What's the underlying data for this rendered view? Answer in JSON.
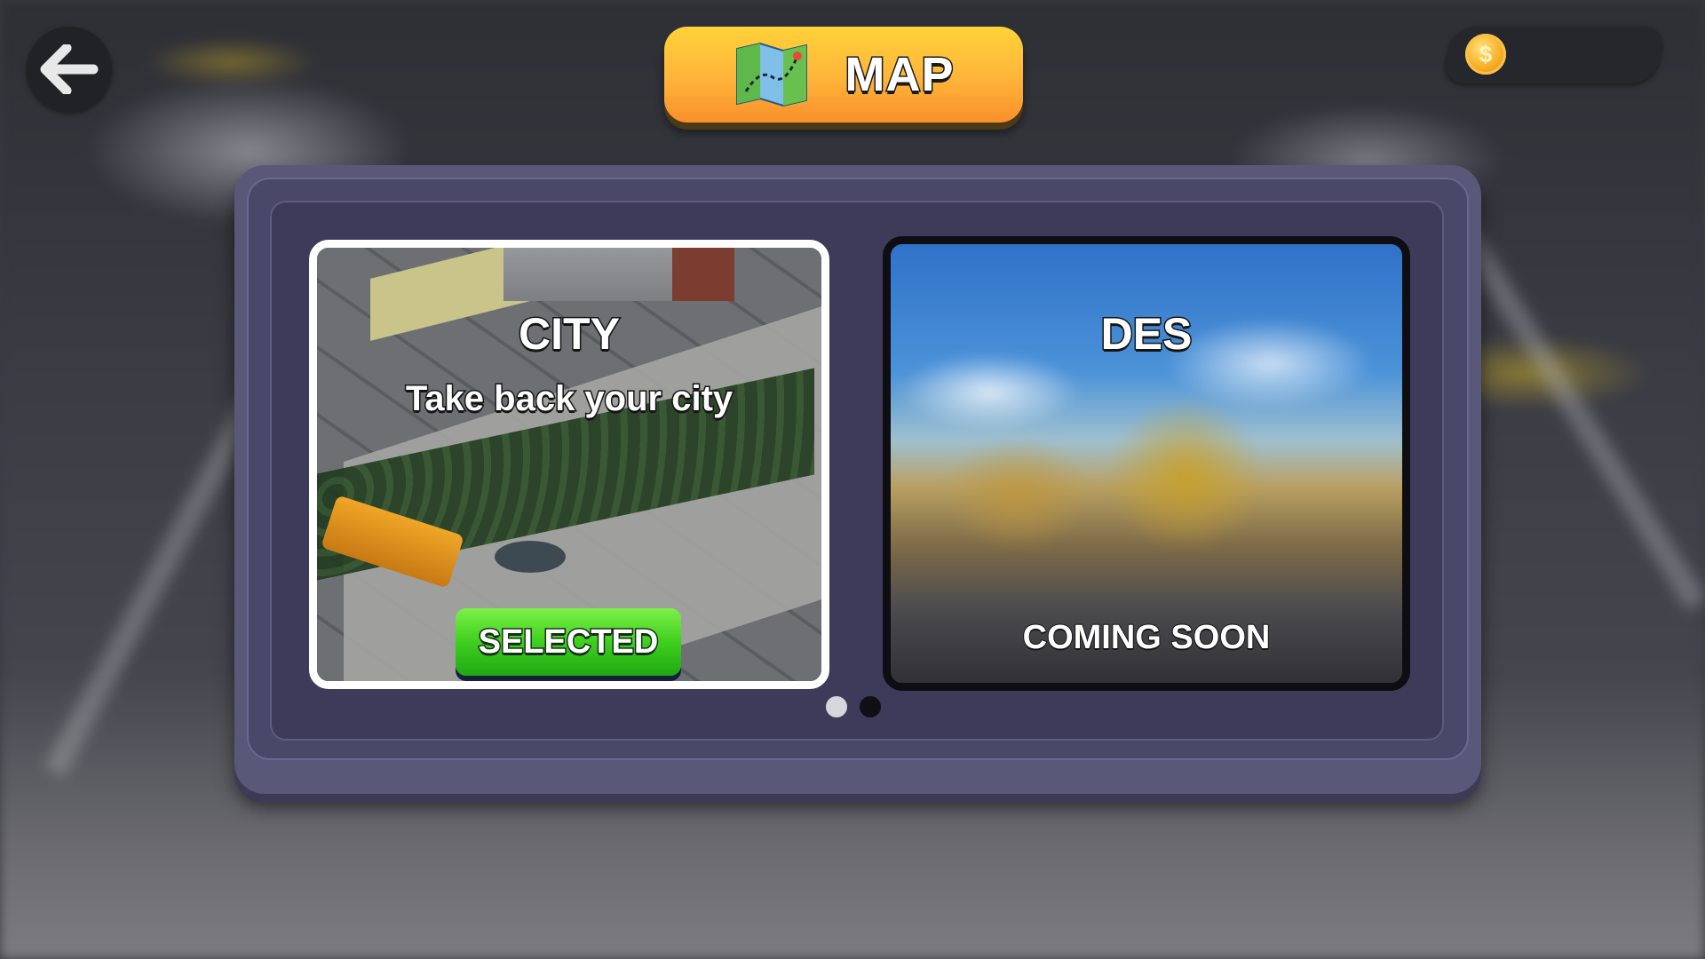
{
  "header": {
    "title": "MAP",
    "back_icon": "arrow-left-icon",
    "title_icon": "map-icon"
  },
  "currency": {
    "icon": "coin-icon",
    "symbol": "$"
  },
  "maps": [
    {
      "name": "CITY",
      "subtitle": "Take back your city",
      "status_label": "SELECTED",
      "selected": true
    },
    {
      "name": "DES",
      "status_label": "COMING SOON",
      "locked": true
    }
  ],
  "pagination": {
    "total_pages": 2,
    "current_page": 1
  },
  "colors": {
    "title_banner": "#ffb43a",
    "selected_button": "#3fcf1f",
    "panel": "#4a4868"
  }
}
